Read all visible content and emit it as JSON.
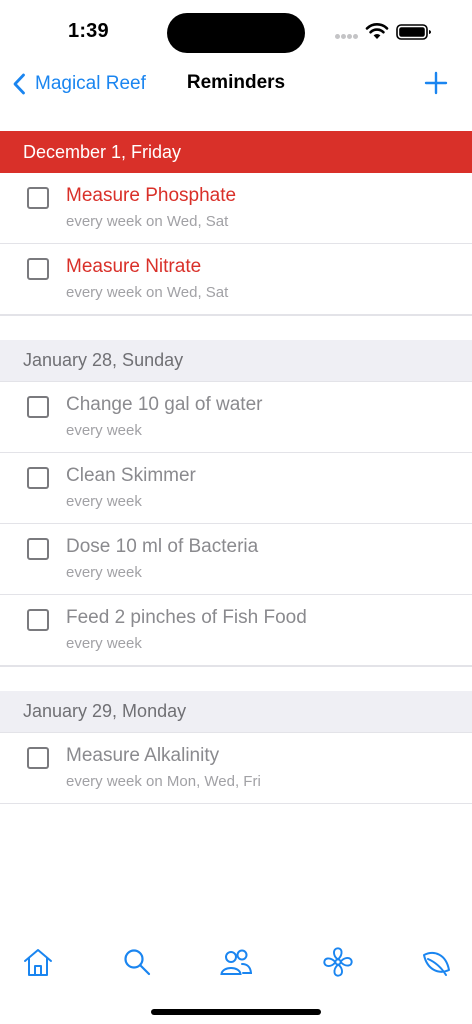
{
  "status_bar": {
    "time": "1:39"
  },
  "nav": {
    "back_label": "Magical Reef",
    "title": "Reminders"
  },
  "sections": [
    {
      "header": "December 1, Friday",
      "overdue": true,
      "items": [
        {
          "title": "Measure Phosphate",
          "subtitle": "every week on Wed, Sat"
        },
        {
          "title": "Measure Nitrate",
          "subtitle": "every week on Wed, Sat"
        }
      ]
    },
    {
      "header": "January 28, Sunday",
      "overdue": false,
      "items": [
        {
          "title": "Change 10 gal of water",
          "subtitle": "every week"
        },
        {
          "title": "Clean Skimmer",
          "subtitle": "every week"
        },
        {
          "title": "Dose 10 ml of Bacteria",
          "subtitle": "every week"
        },
        {
          "title": "Feed 2 pinches of Fish Food",
          "subtitle": "every week"
        }
      ]
    },
    {
      "header": "January 29, Monday",
      "overdue": false,
      "items": [
        {
          "title": "Measure Alkalinity",
          "subtitle": "every week on Mon, Wed, Fri"
        }
      ]
    }
  ],
  "tab_bar": {
    "tabs": [
      {
        "icon": "home-icon"
      },
      {
        "icon": "search-icon"
      },
      {
        "icon": "people-icon"
      },
      {
        "icon": "fan-icon"
      },
      {
        "icon": "leaf-icon"
      }
    ]
  },
  "colors": {
    "accent": "#1a85f0",
    "overdue": "#d93029"
  }
}
